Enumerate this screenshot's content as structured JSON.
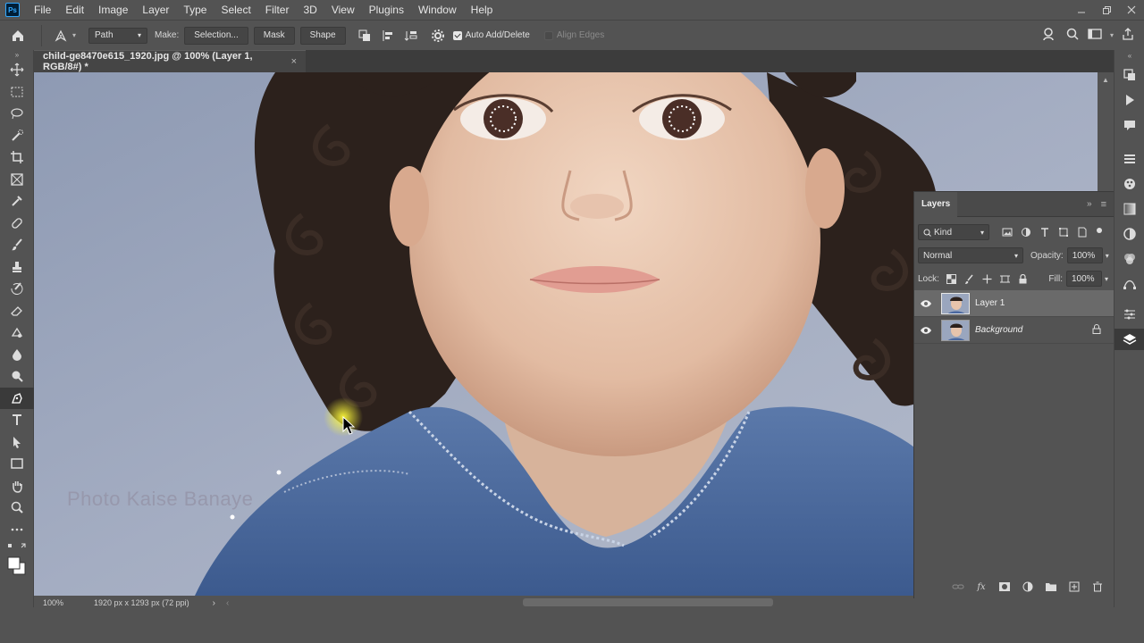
{
  "app": {
    "logo": "Ps"
  },
  "menu": [
    "File",
    "Edit",
    "Image",
    "Layer",
    "Type",
    "Select",
    "Filter",
    "3D",
    "View",
    "Plugins",
    "Window",
    "Help"
  ],
  "options": {
    "mode": "Path",
    "make_label": "Make:",
    "selection_btn": "Selection...",
    "mask_btn": "Mask",
    "shape_btn": "Shape",
    "auto_add_label": "Auto Add/Delete",
    "align_edges_label": "Align Edges"
  },
  "document": {
    "tab_title": "child-ge8470e615_1920.jpg @ 100% (Layer 1, RGB/8#) *",
    "watermark": "Photo Kaise Banaye"
  },
  "status": {
    "zoom": "100%",
    "dimensions": "1920 px x 1293 px (72 ppi)"
  },
  "layers_panel": {
    "title": "Layers",
    "filter_kind": "Kind",
    "blend_mode": "Normal",
    "opacity_label": "Opacity:",
    "opacity": "100%",
    "lock_label": "Lock:",
    "fill_label": "Fill:",
    "fill": "100%",
    "layers": [
      {
        "name": "Layer 1",
        "selected": true
      },
      {
        "name": "Background",
        "selected": false,
        "locked": true
      }
    ]
  },
  "colors": {
    "ui_bg": "#535353",
    "panel_dark": "#3a3a3a",
    "accent": "#31a8ff"
  }
}
